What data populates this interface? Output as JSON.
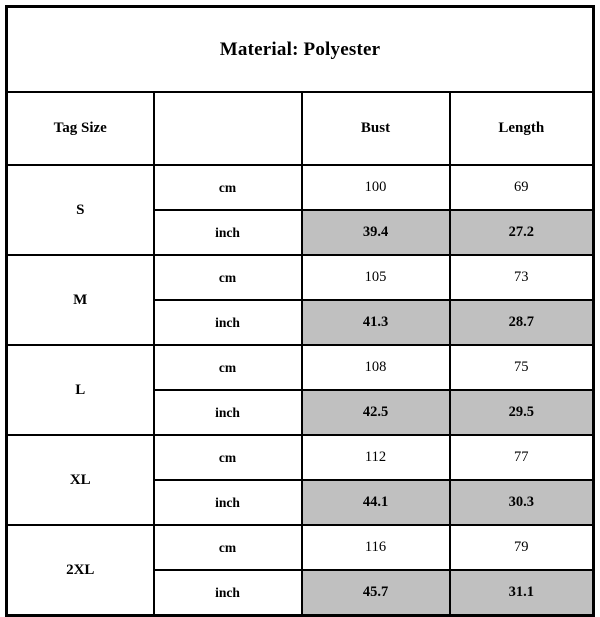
{
  "chart_data": {
    "type": "table",
    "title": "Material: Polyester",
    "columns": [
      "Tag Size",
      "",
      "Bust",
      "Length"
    ],
    "units": [
      "cm",
      "inch"
    ],
    "rows": [
      {
        "size": "S",
        "cm": {
          "bust": "100",
          "length": "69"
        },
        "inch": {
          "bust": "39.4",
          "length": "27.2"
        }
      },
      {
        "size": "M",
        "cm": {
          "bust": "105",
          "length": "73"
        },
        "inch": {
          "bust": "41.3",
          "length": "28.7"
        }
      },
      {
        "size": "L",
        "cm": {
          "bust": "108",
          "length": "75"
        },
        "inch": {
          "bust": "42.5",
          "length": "29.5"
        }
      },
      {
        "size": "XL",
        "cm": {
          "bust": "112",
          "length": "77"
        },
        "inch": {
          "bust": "44.1",
          "length": "30.3"
        }
      },
      {
        "size": "2XL",
        "cm": {
          "bust": "116",
          "length": "79"
        },
        "inch": {
          "bust": "45.7",
          "length": "31.1"
        }
      }
    ],
    "colors": {
      "border": "#000000",
      "shaded_cell": "#c0c0c0",
      "background": "#ffffff",
      "text": "#000000"
    }
  }
}
